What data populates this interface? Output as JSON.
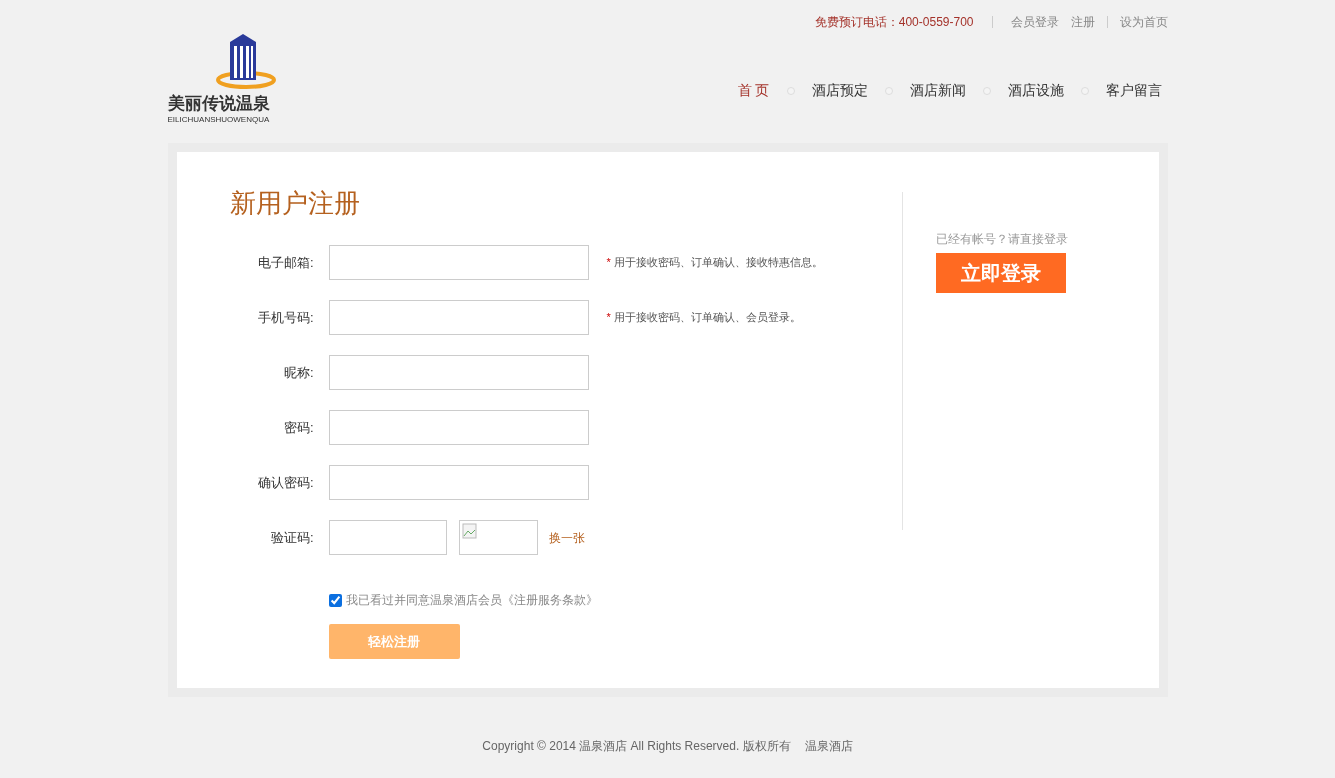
{
  "top_bar": {
    "phone": "免费预订电话：400-0559-700",
    "links": [
      "会员登录",
      "注册"
    ],
    "home_link": "设为首页"
  },
  "logo": {
    "name": "美丽传说温泉",
    "subtitle": "EILICHUANSHUOWENQUA"
  },
  "nav": [
    {
      "label": "首 页",
      "selected": true
    },
    {
      "label": "酒店预定",
      "selected": false
    },
    {
      "label": "酒店新闻",
      "selected": false
    },
    {
      "label": "酒店设施",
      "selected": false
    },
    {
      "label": "客户留言",
      "selected": false
    }
  ],
  "form": {
    "title": "新用户注册",
    "fields": [
      {
        "label": "电子邮箱:",
        "required_mark": "*",
        "hint": "用于接收密码、订单确认、接收特惠信息。"
      },
      {
        "label": "手机号码:",
        "required_mark": "*",
        "hint": "用于接收密码、订单确认、会员登录。"
      },
      {
        "label": "昵称:"
      },
      {
        "label": "密码:"
      },
      {
        "label": "确认密码:"
      }
    ],
    "captcha": {
      "label": "验证码:",
      "refresh_link": "换一张"
    },
    "agreement": {
      "checked": true,
      "text": "我已看过并同意温泉酒店会员《注册服务条款》"
    },
    "submit": "轻松注册"
  },
  "side": {
    "prompt": "已经有帐号？请直接登录",
    "login_button": "立即登录"
  },
  "footer": {
    "copyright": "Copyright © 2014 温泉酒店 All Rights Reserved. 版权所有",
    "site_name": "温泉酒店"
  }
}
